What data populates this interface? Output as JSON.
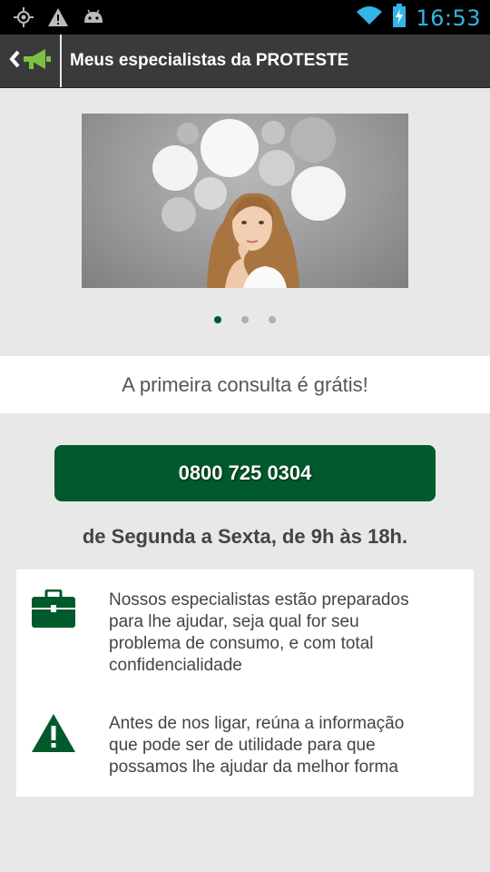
{
  "status_bar": {
    "time": "16:53",
    "icons": [
      "gps-icon",
      "warning-icon",
      "android-icon",
      "wifi-icon",
      "battery-charging-icon"
    ]
  },
  "action_bar": {
    "title": "Meus especialistas da PROTESTE",
    "home_icon": "megaphone-back-icon"
  },
  "carousel": {
    "pages": 3,
    "active_page": 1
  },
  "promo": {
    "text": "A primeira consulta é grátis!"
  },
  "call": {
    "phone": "0800 725 0304",
    "hours": "de Segunda a Sexta, de 9h às 18h."
  },
  "info": {
    "items": [
      {
        "icon": "briefcase-icon",
        "lines": [
          "Nossos especialistas estão preparados",
          "para lhe ajudar, seja qual for seu",
          "problema de consumo, e com total",
          "confidencialidade"
        ]
      },
      {
        "icon": "warning-icon",
        "lines": [
          "Antes de nos ligar, reúna a informação",
          "que pode ser de utilidade para que",
          "possamos lhe ajudar da melhor forma"
        ]
      }
    ]
  },
  "colors": {
    "brand_green": "#005a2b",
    "status_accent": "#33b5e5",
    "background": "#e8e8e8"
  }
}
